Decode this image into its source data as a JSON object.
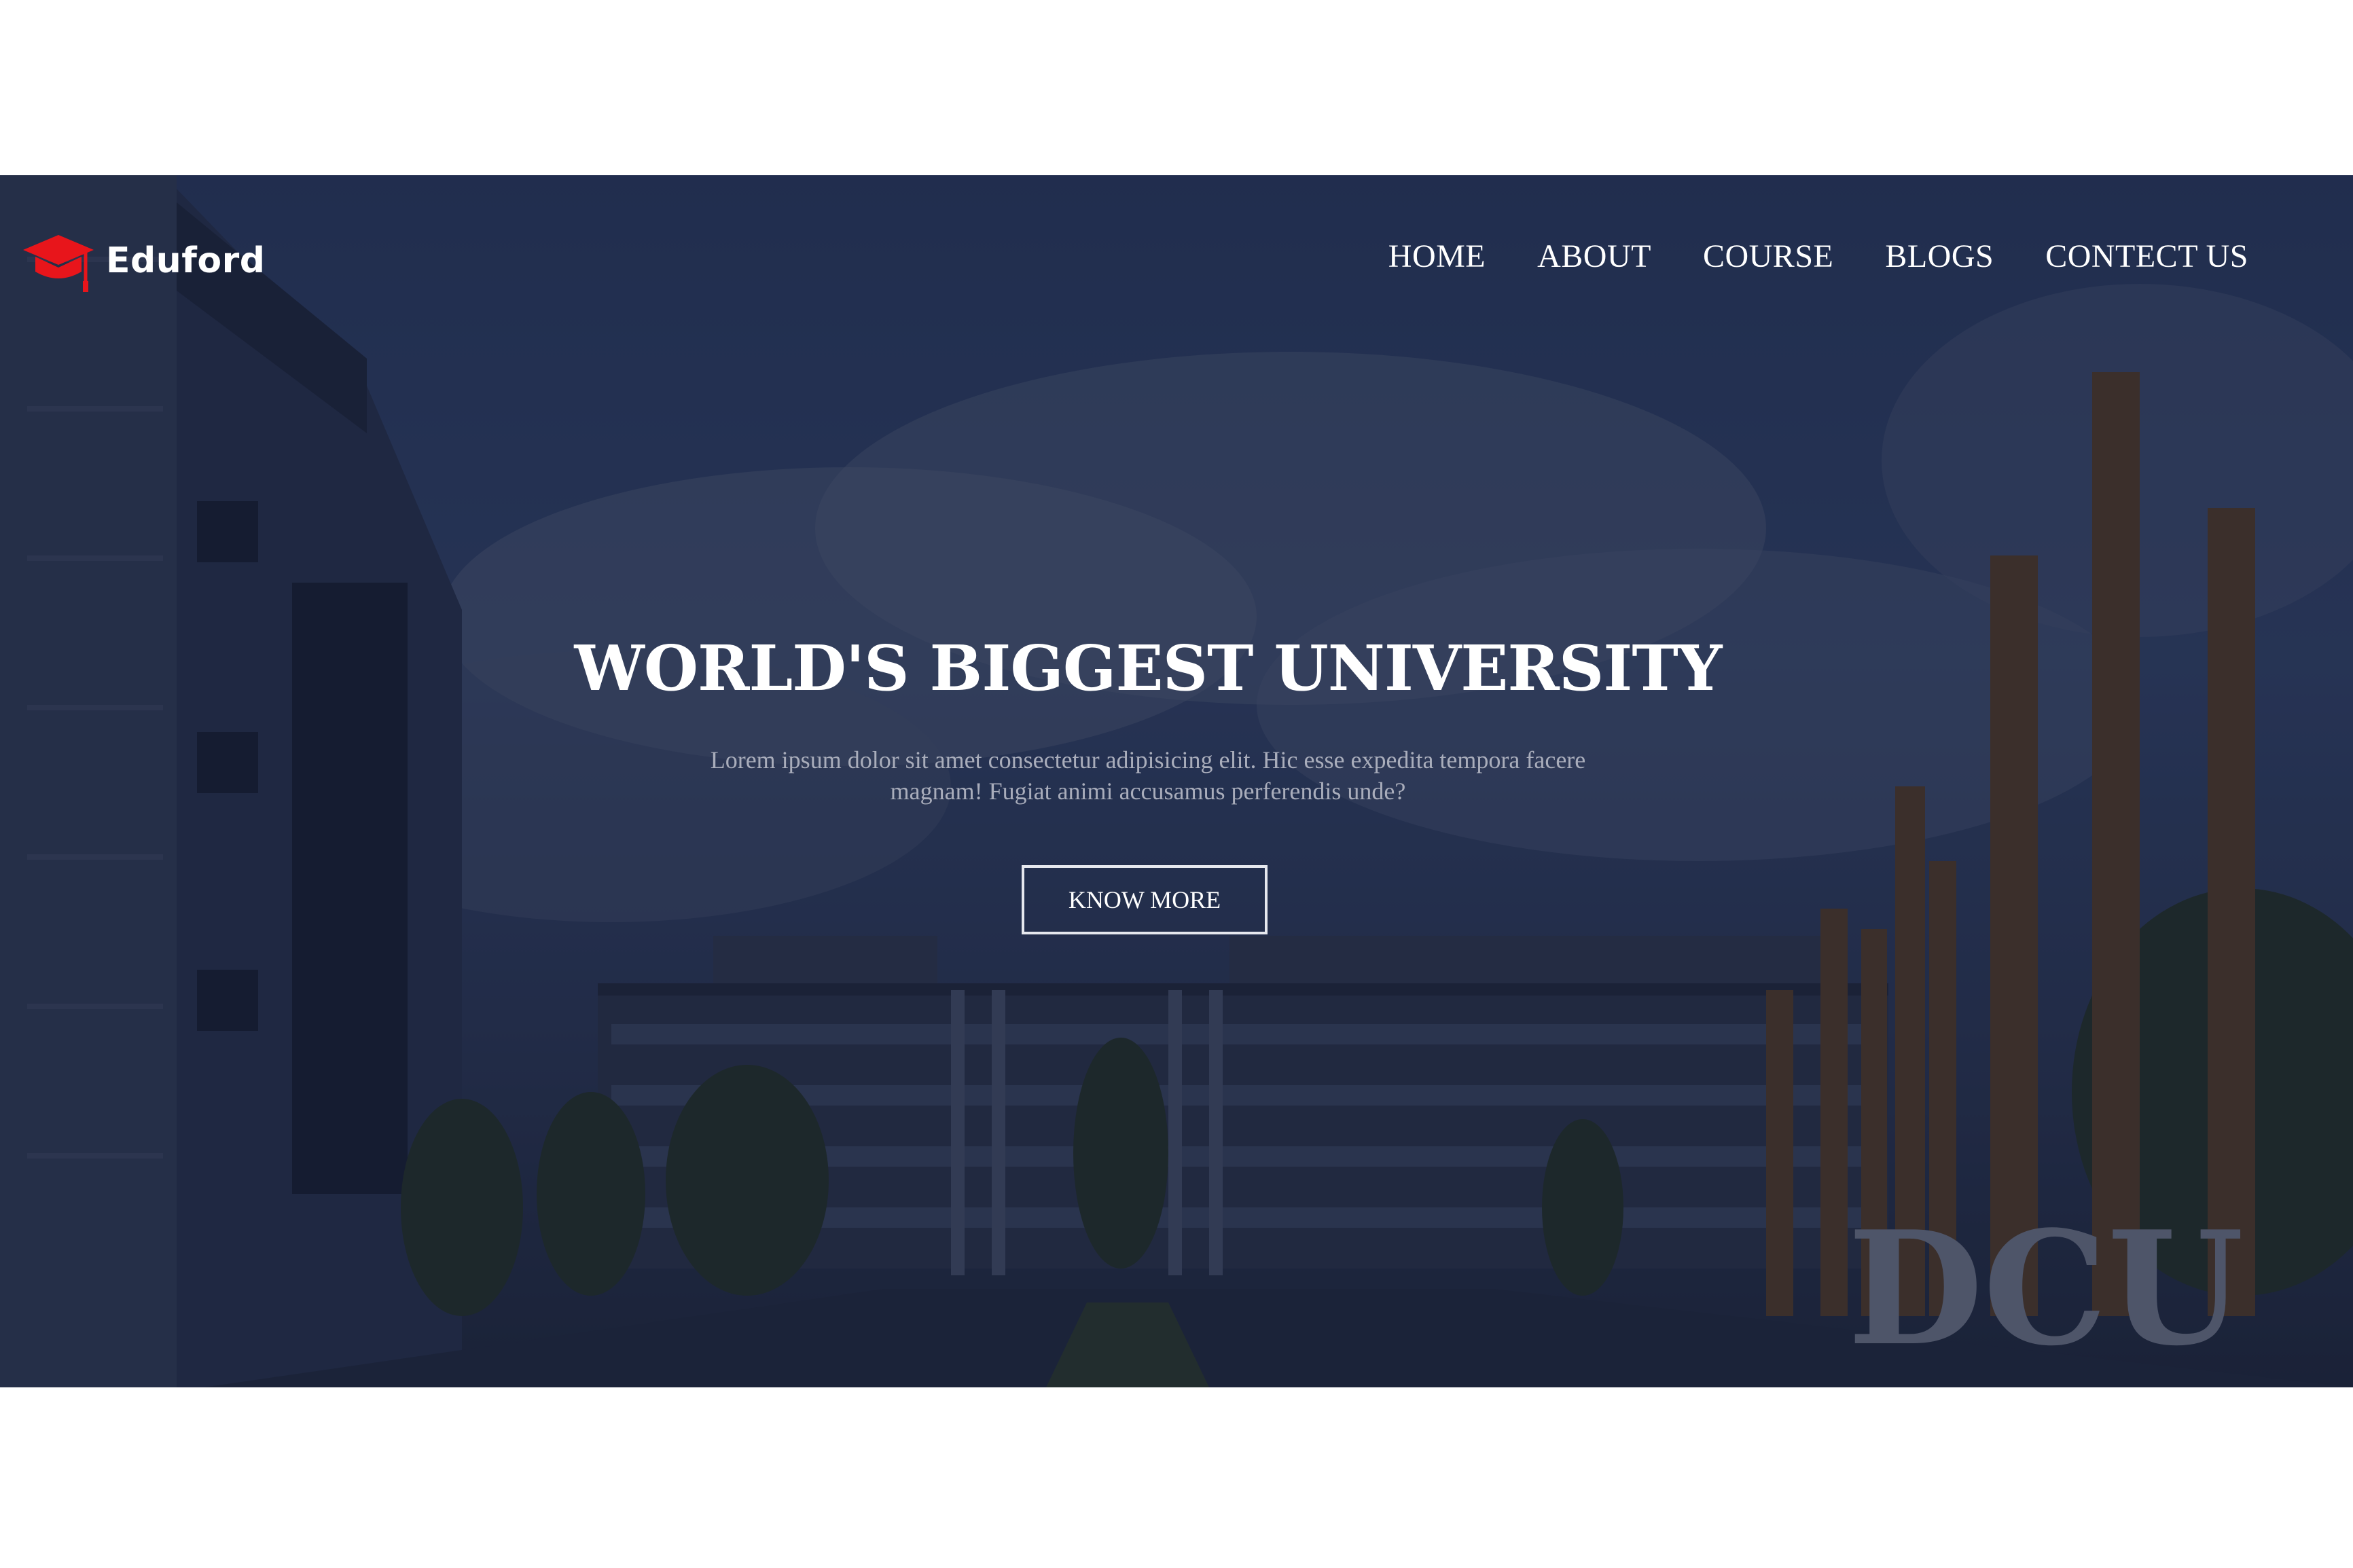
{
  "brand": {
    "name": "Eduford",
    "icon": "graduation-cap-icon",
    "icon_color": "#e8151b"
  },
  "nav": {
    "items": [
      {
        "label": "HOME"
      },
      {
        "label": "ABOUT"
      },
      {
        "label": "COURSE"
      },
      {
        "label": "BLOGS"
      },
      {
        "label": "CONTECT US"
      }
    ]
  },
  "hero": {
    "headline": "WORLD'S BIGGEST UNIVERSITY",
    "description": "Lorem ipsum dolor sit amet consectetur adipisicing elit. Hic esse expedita tempora facere magnam! Fugiat animi accusamus perferendis unde?",
    "cta_label": "KNOW MORE",
    "overlay_color": "#161e3a",
    "sign_text": "DCU"
  }
}
